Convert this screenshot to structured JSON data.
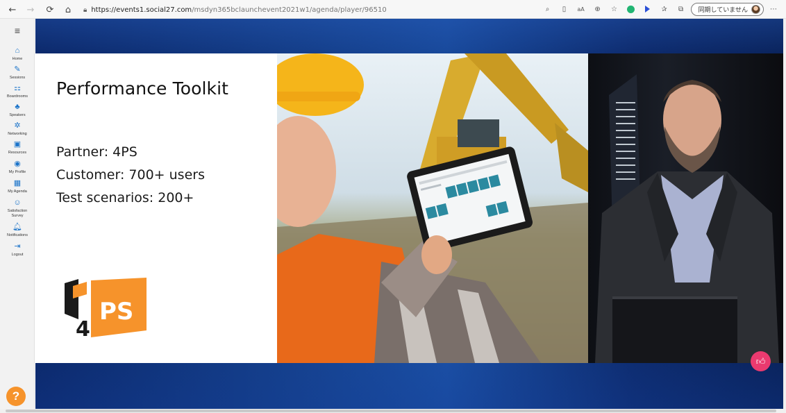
{
  "browser": {
    "url_host": "https://events1.social27.com",
    "url_path": "/msdyn365bclaunchevent2021w1/agenda/player/96510",
    "sync_label": "同期していません"
  },
  "sidebar": {
    "items": [
      {
        "label": "Home",
        "icon": "home-icon"
      },
      {
        "label": "Sessions",
        "icon": "pencil-icon"
      },
      {
        "label": "Boardrooms",
        "icon": "boardroom-icon"
      },
      {
        "label": "Speakers",
        "icon": "speakers-icon"
      },
      {
        "label": "Networking",
        "icon": "networking-icon"
      },
      {
        "label": "Resources",
        "icon": "resources-icon"
      },
      {
        "label": "My Profile",
        "icon": "profile-icon"
      },
      {
        "label": "My Agenda",
        "icon": "calendar-icon"
      },
      {
        "label": "Satisfaction Survey",
        "icon": "survey-icon"
      },
      {
        "label": "Notifications",
        "icon": "bell-icon"
      },
      {
        "label": "Logout",
        "icon": "logout-icon"
      }
    ],
    "help_label": "?"
  },
  "slide": {
    "title": "Performance Toolkit",
    "lines": [
      "Partner: 4PS",
      "Customer: 700+ users",
      "Test scenarios: 200+"
    ],
    "logo_text_number": "4",
    "logo_text_letters": "PS"
  },
  "colors": {
    "accent_orange": "#f6932b",
    "like_pink": "#ea3a6f",
    "nav_blue": "#1a73c9",
    "stage_blue": "#15418f"
  }
}
